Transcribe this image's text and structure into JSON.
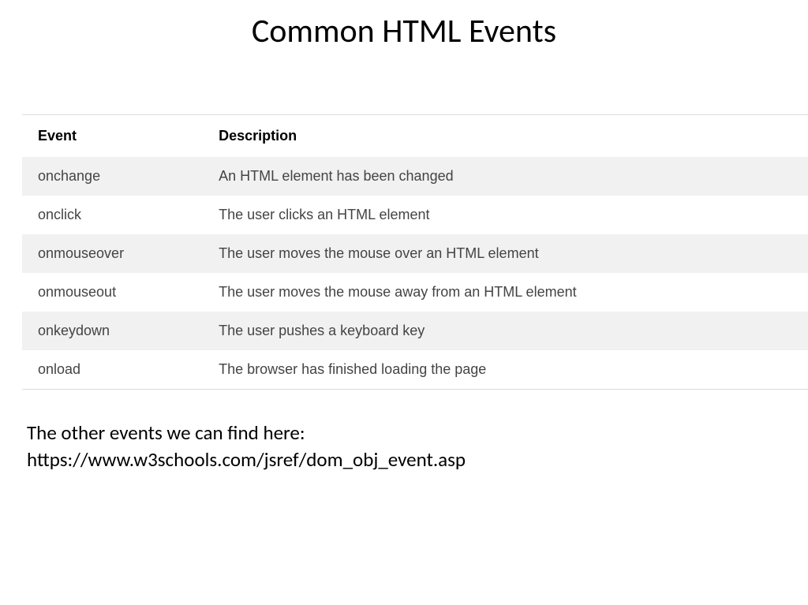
{
  "title": "Common HTML Events",
  "table": {
    "headers": {
      "event": "Event",
      "description": "Description"
    },
    "rows": [
      {
        "event": "onchange",
        "description": "An HTML element has been changed"
      },
      {
        "event": "onclick",
        "description": "The user clicks an HTML element"
      },
      {
        "event": "onmouseover",
        "description": "The user moves the mouse over an HTML element"
      },
      {
        "event": "onmouseout",
        "description": "The user moves the mouse away from an HTML element"
      },
      {
        "event": "onkeydown",
        "description": "The user pushes a keyboard key"
      },
      {
        "event": "onload",
        "description": "The browser has finished loading the page"
      }
    ]
  },
  "footer": {
    "line1": "The other events we can find here:",
    "line2": "https://www.w3schools.com/jsref/dom_obj_event.asp"
  }
}
